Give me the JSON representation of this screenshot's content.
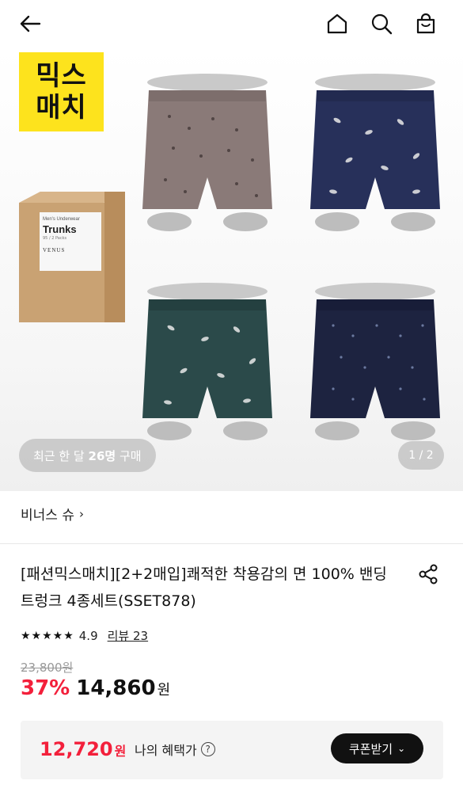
{
  "header": {
    "back_icon": "arrow-left-icon",
    "home_icon": "home-icon",
    "search_icon": "search-icon",
    "bag_icon": "shopping-bag-icon"
  },
  "hero": {
    "badge_line1": "믹스",
    "badge_line2": "매치",
    "box_subtitle": "Men's Underwear",
    "box_title": "Trunks",
    "box_pack": "95 / 2 Packs",
    "box_brand": "VENUS",
    "buy_prefix": "최근 한 달 ",
    "buy_count": "26명",
    "buy_suffix": " 구매",
    "page_indicator": "1 / 2",
    "trunk_colors": [
      "#8a7a78",
      "#27305a",
      "#2b4a4a",
      "#1d2340"
    ]
  },
  "brand": {
    "name": "비너스 슈",
    "chevron": "›"
  },
  "product": {
    "title": "[패션믹스매치][2+2매입]쾌적한 착용감의 면 100% 밴딩 트렁크 4종세트(SSET878)",
    "stars": "★★★★★",
    "rating": "4.9",
    "review_label": "리뷰 23",
    "original_price": "23,800원",
    "discount": "37%",
    "price": "14,860",
    "currency": "원"
  },
  "benefit": {
    "price": "12,720",
    "currency": "원",
    "label": "나의 혜택가",
    "help_icon": "?",
    "coupon_button": "쿠폰받기",
    "coupon_chevron": "⌄"
  },
  "colors": {
    "accent_red": "#f3203b",
    "badge_yellow": "#fde31d"
  }
}
